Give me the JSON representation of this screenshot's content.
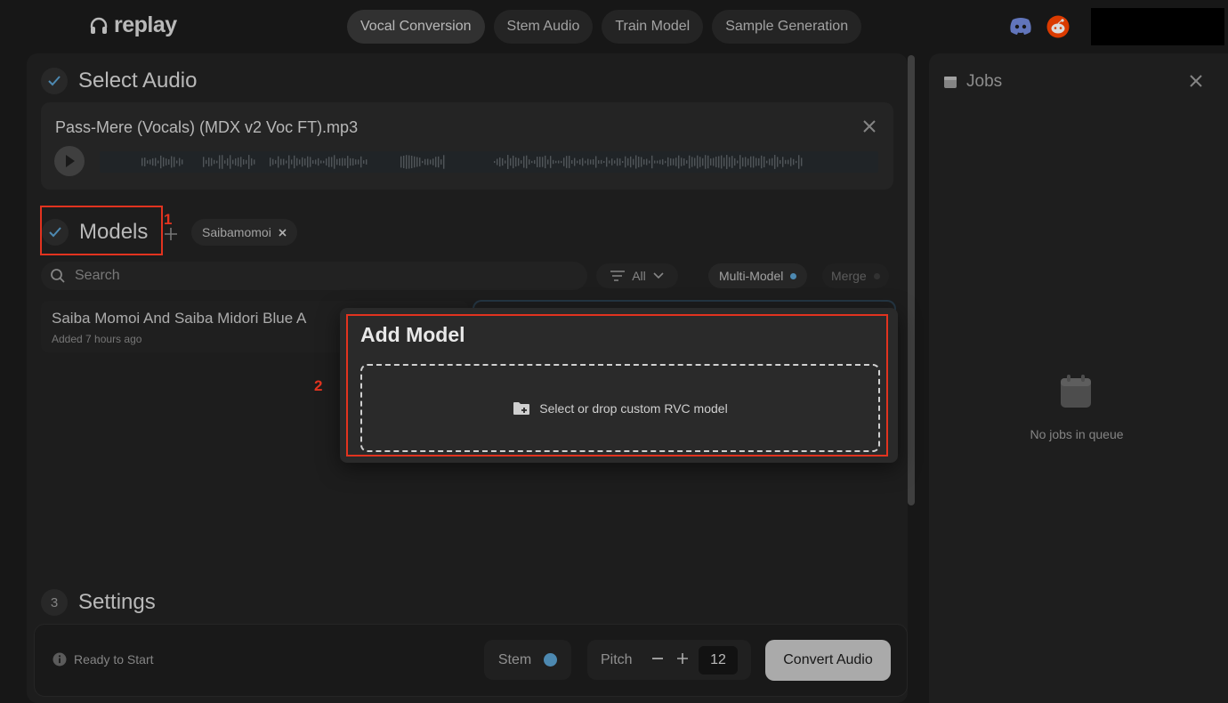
{
  "app": {
    "name": "replay"
  },
  "nav": {
    "tabs": [
      {
        "label": "Vocal Conversion"
      },
      {
        "label": "Stem Audio"
      },
      {
        "label": "Train Model"
      },
      {
        "label": "Sample Generation"
      }
    ]
  },
  "sections": {
    "select_audio": {
      "title": "Select Audio"
    },
    "models": {
      "title": "Models"
    },
    "settings": {
      "number": "3",
      "title": "Settings"
    }
  },
  "audio": {
    "file_name": "Pass-Mere (Vocals) (MDX v2 Voc FT).mp3"
  },
  "models": {
    "selected_chip": "Saibamomoi",
    "search_placeholder": "Search",
    "filter_label": "All",
    "multi_model_label": "Multi-Model",
    "merge_label": "Merge",
    "list": [
      {
        "title": "Saiba Momoi And Saiba Midori Blue A",
        "added": "Added 7 hours ago"
      }
    ]
  },
  "bottom": {
    "status": "Ready to Start",
    "stem_label": "Stem",
    "pitch_label": "Pitch",
    "pitch_value": "12",
    "convert_label": "Convert Audio"
  },
  "jobs": {
    "title": "Jobs",
    "empty_text": "No jobs in queue"
  },
  "popup": {
    "title": "Add Model",
    "dropzone_text": "Select or drop custom RVC model"
  },
  "annotations": {
    "one": "1",
    "two": "2"
  },
  "colors": {
    "accent_blue": "#5aa0cf",
    "annotation_red": "#e2331f",
    "discord": "#7289da",
    "reddit": "#ff4500"
  }
}
